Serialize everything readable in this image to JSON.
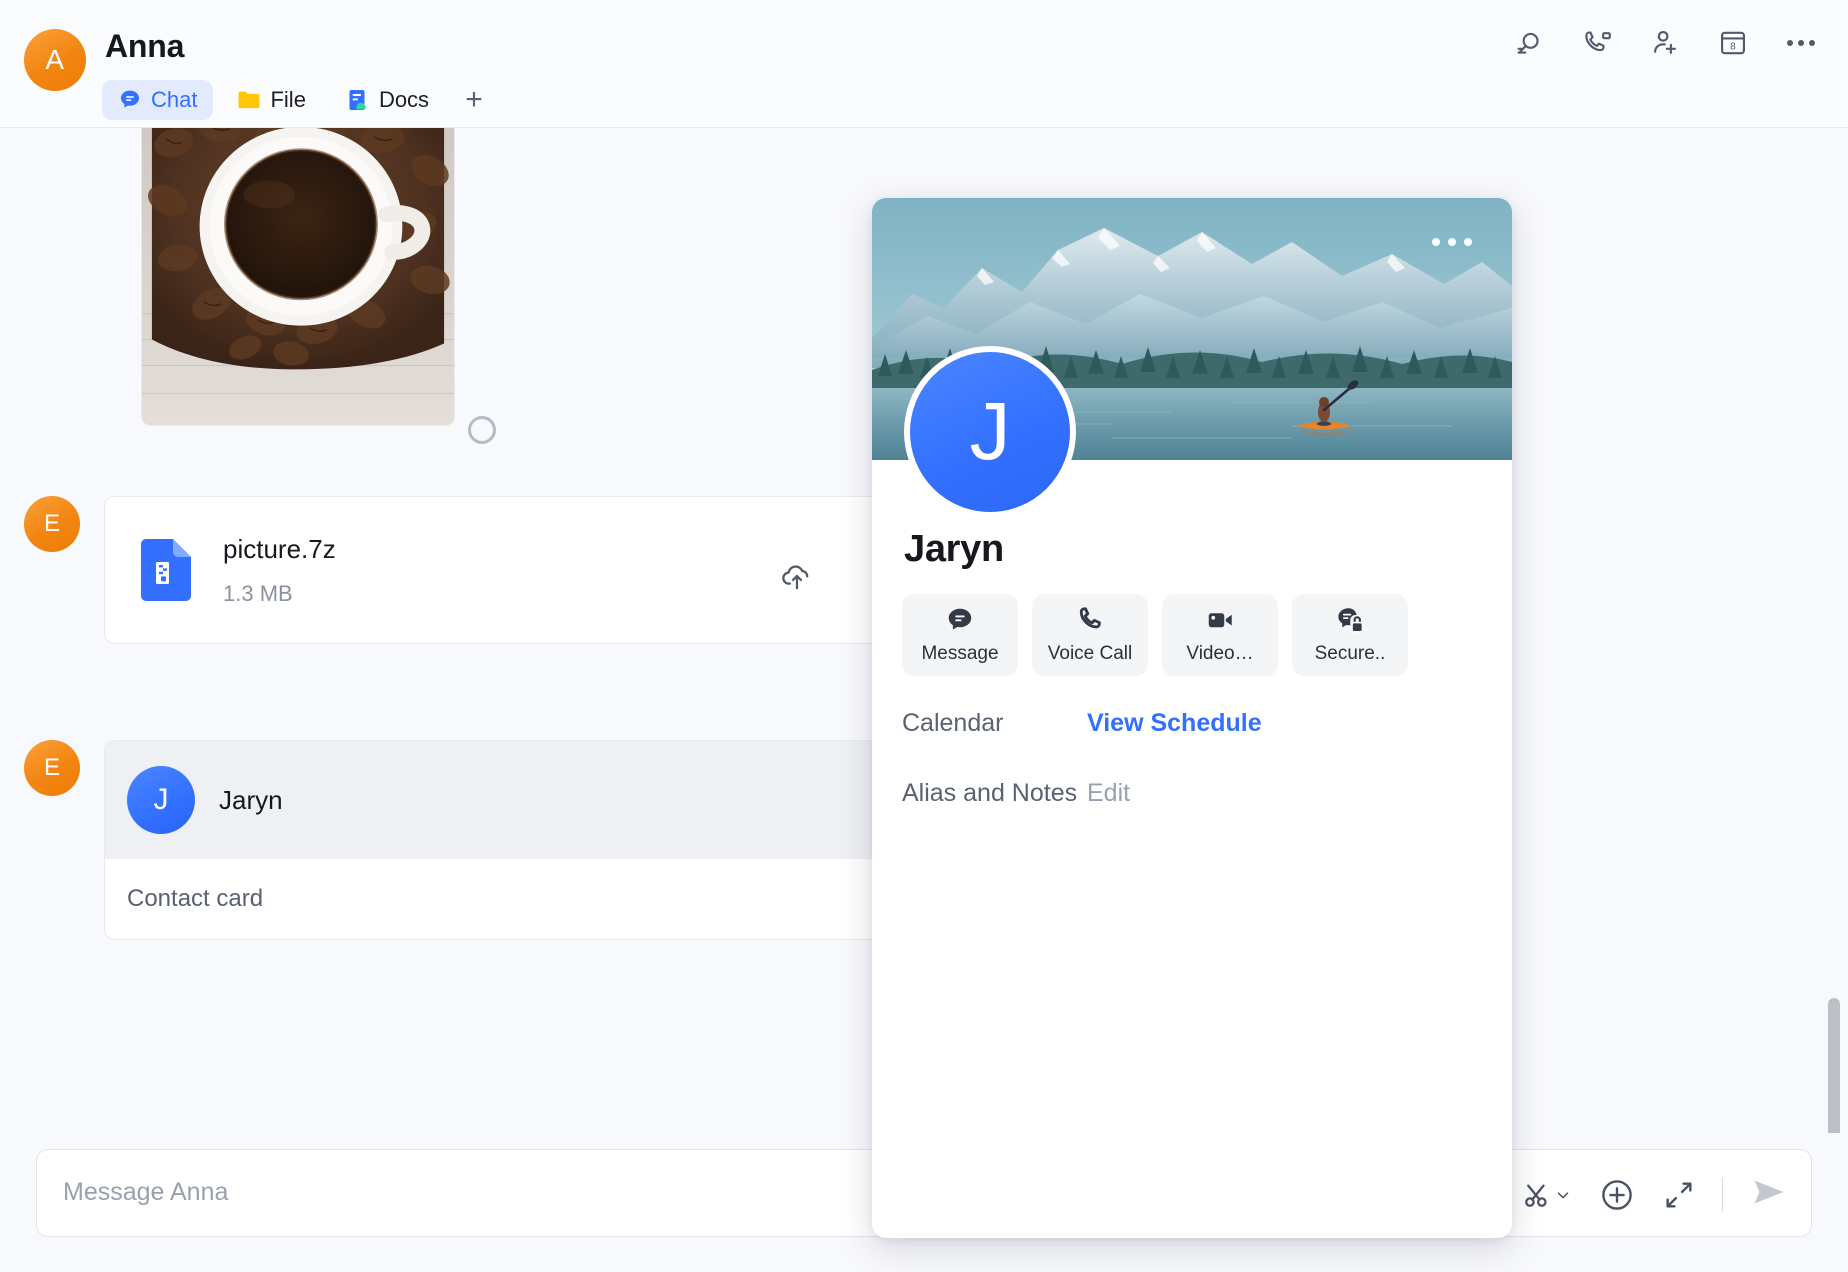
{
  "header": {
    "avatar_letter": "A",
    "title": "Anna",
    "tabs": [
      {
        "label": "Chat",
        "icon": "chat-icon",
        "active": true
      },
      {
        "label": "File",
        "icon": "folder-icon",
        "active": false
      },
      {
        "label": "Docs",
        "icon": "docs-icon",
        "active": false
      }
    ],
    "add_tab_label": "+",
    "actions": [
      {
        "name": "search-icon"
      },
      {
        "name": "video-phone-icon"
      },
      {
        "name": "add-person-icon"
      },
      {
        "name": "calendar-icon",
        "value": "8"
      },
      {
        "name": "more-options-icon"
      }
    ]
  },
  "messages": [
    {
      "type": "image",
      "sender_initial": "",
      "alt": "coffee cup on coffee beans",
      "status": "sending"
    },
    {
      "type": "file",
      "sender_initial": "E",
      "file_name": "picture.7z",
      "file_size": "1.3 MB",
      "actions": [
        "cloud-upload-icon",
        "download-icon"
      ]
    },
    {
      "type": "contact",
      "sender_initial": "E",
      "contact_initial": "J",
      "contact_name": "Jaryn",
      "footer_label": "Contact card"
    }
  ],
  "composer": {
    "placeholder": "Message Anna",
    "value": "",
    "tools": [
      {
        "name": "scissors-dropdown-icon"
      },
      {
        "name": "plus-circle-icon"
      },
      {
        "name": "expand-icon"
      }
    ],
    "send_label": "send-icon"
  },
  "profile_card": {
    "banner_alt": "kayaker on mountain lake",
    "banner_menu": "more-options-icon",
    "avatar_letter": "J",
    "name": "Jaryn",
    "actions": [
      {
        "label": "Message",
        "icon": "message-icon"
      },
      {
        "label": "Voice Call",
        "icon": "phone-icon"
      },
      {
        "label": "Video…",
        "icon": "video-camera-icon"
      },
      {
        "label": "Secure..",
        "icon": "secure-chat-icon"
      }
    ],
    "rows": [
      {
        "label": "Calendar",
        "value": "View Schedule",
        "style": "link"
      },
      {
        "label": "Alias and Notes",
        "value": "Edit",
        "style": "muted"
      }
    ]
  },
  "colors": {
    "accent": "#3370ff",
    "avatar_orange": "#f28511",
    "background": "#f8f9fc",
    "text": "#16181d",
    "muted": "#8a91a0"
  }
}
